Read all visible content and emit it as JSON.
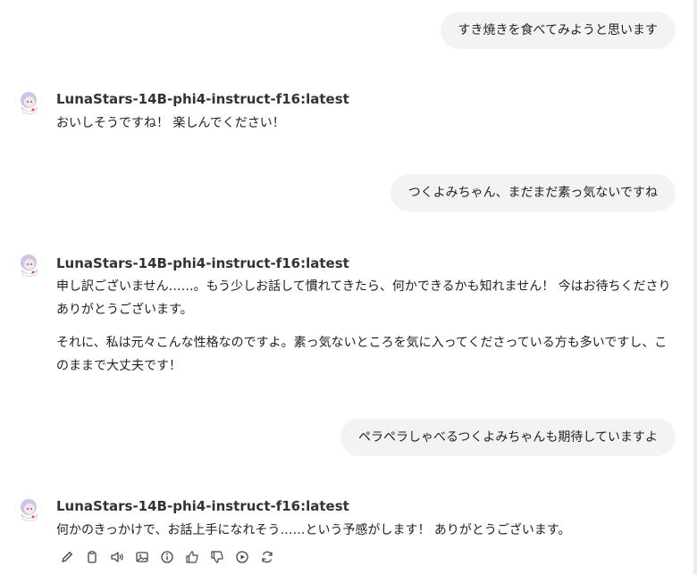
{
  "messages": {
    "user1": "すき焼きを食べてみようと思います",
    "assistant1": {
      "model": "LunaStars-14B-phi4-instruct-f16:latest",
      "paragraphs": [
        "おいしそうですね！ 楽しんでください！"
      ]
    },
    "user2": "つくよみちゃん、まだまだ素っ気ないですね",
    "assistant2": {
      "model": "LunaStars-14B-phi4-instruct-f16:latest",
      "paragraphs": [
        "申し訳ございません……。もう少しお話して慣れてきたら、何かできるかも知れません！ 今はお待ちくださりありがとうございます。",
        "それに、私は元々こんな性格なのですよ。素っ気ないところを気に入ってくださっている方も多いですし、このままで大丈夫です！"
      ]
    },
    "user3": "ペラペラしゃべるつくよみちゃんも期待していますよ",
    "assistant3": {
      "model": "LunaStars-14B-phi4-instruct-f16:latest",
      "paragraphs": [
        "何かのきっかけで、お話上手になれそう……という予感がします！ ありがとうございます。"
      ]
    }
  },
  "action_icons": [
    "edit-icon",
    "copy-icon",
    "speaker-icon",
    "image-icon",
    "info-icon",
    "thumbs-up-icon",
    "thumbs-down-icon",
    "play-icon",
    "regenerate-icon"
  ],
  "colors": {
    "bubble": "#f3f3f3",
    "text": "#222222",
    "icon": "#444444"
  }
}
